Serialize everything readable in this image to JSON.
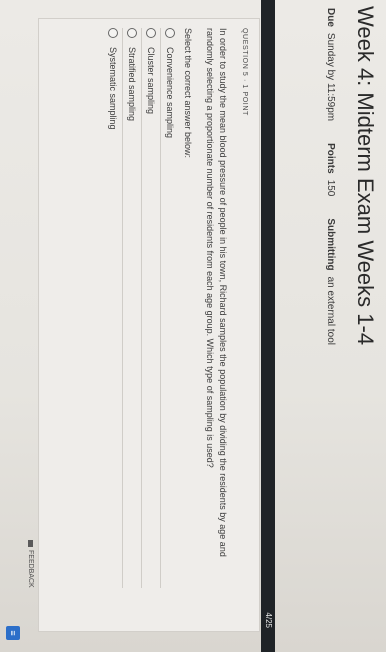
{
  "header": {
    "title": "Week 4: Midterm Exam Weeks 1-4",
    "due_label": "Due",
    "due_value": "Sunday by 11:59pm",
    "points_label": "Points",
    "points_value": "150",
    "submitting_label": "Submitting",
    "submitting_value": "an external tool"
  },
  "banner": {
    "count": "4/25"
  },
  "question": {
    "label": "QUESTION 5 · 1 POINT",
    "text": "In order to study the mean blood pressure of people in his town, Richard samples the population by dividing the residents by age and randomly selecting a proportionate number of residents from each age group. Which type of sampling is used?",
    "prompt": "Select the correct answer below:",
    "options": [
      "Convenience sampling",
      "Cluster sampling",
      "Stratified sampling",
      "Systematic sampling"
    ]
  },
  "footer": {
    "feedback_label": "FEEDBACK",
    "feedback_icon": "feedback-icon",
    "tool_icon": "list-icon",
    "tool_glyph": "≡"
  }
}
